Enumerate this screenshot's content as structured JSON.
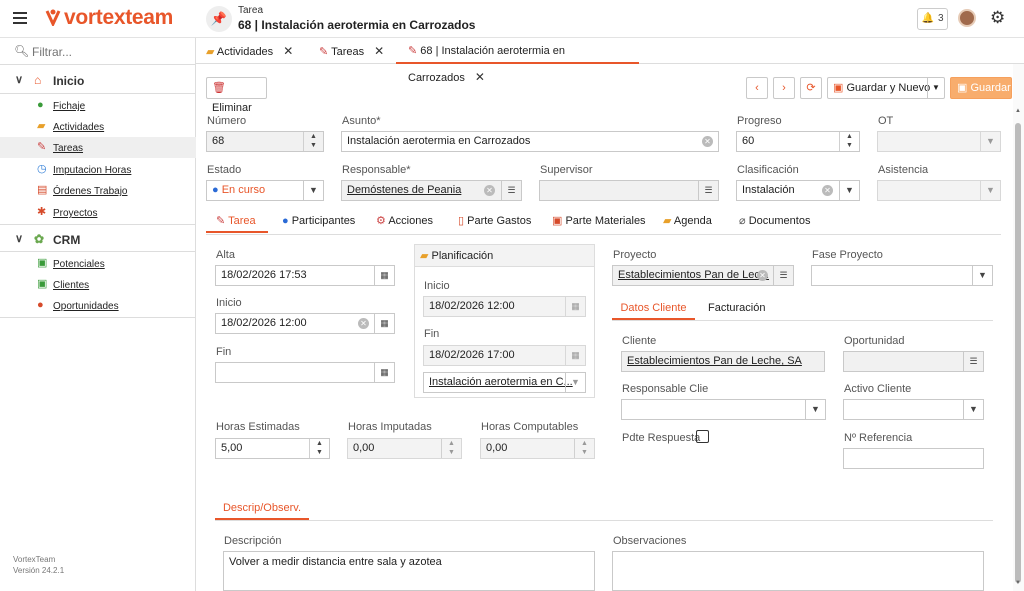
{
  "header": {
    "brand": "vortexteam",
    "task_kind": "Tarea",
    "task_title": "68 | Instalación aerotermia en Carrozados",
    "notifications_count": "3"
  },
  "sidebar": {
    "filter_placeholder": "Filtrar...",
    "sections": [
      {
        "label": "Inicio",
        "items": [
          {
            "label": "Fichaje",
            "icon": "user-clock-icon"
          },
          {
            "label": "Actividades",
            "icon": "activities-icon"
          },
          {
            "label": "Tareas",
            "icon": "tasks-icon",
            "selected": true
          },
          {
            "label": "Imputacion Horas",
            "icon": "clock-icon"
          },
          {
            "label": "Órdenes Trabajo",
            "icon": "work-orders-icon"
          },
          {
            "label": "Proyectos",
            "icon": "projects-icon"
          }
        ]
      },
      {
        "label": "CRM",
        "items": [
          {
            "label": "Potenciales",
            "icon": "leads-icon"
          },
          {
            "label": "Clientes",
            "icon": "clients-icon"
          },
          {
            "label": "Oportunidades",
            "icon": "opportunities-icon"
          }
        ]
      }
    ],
    "footer_app": "VortexTeam",
    "footer_version": "Versión 24.2.1"
  },
  "tabs": [
    {
      "label": "Actividades"
    },
    {
      "label": "Tareas"
    },
    {
      "label": "68 | Instalación aerotermia en Carrozados",
      "active": true
    }
  ],
  "toolbar": {
    "delete_label": "Eliminar",
    "save_new_label": "Guardar y Nuevo",
    "save_label": "Guardar"
  },
  "form": {
    "numero_label": "Número",
    "numero_value": "68",
    "asunto_label": "Asunto*",
    "asunto_value": "Instalación aerotermia en Carrozados",
    "progreso_label": "Progreso",
    "progreso_value": "60",
    "ot_label": "OT",
    "ot_value": "",
    "estado_label": "Estado",
    "estado_value": "En curso",
    "responsable_label": "Responsable*",
    "responsable_value": "Demóstenes de Peania",
    "supervisor_label": "Supervisor",
    "supervisor_value": "",
    "clasificacion_label": "Clasificación",
    "clasificacion_value": "Instalación",
    "asistencia_label": "Asistencia",
    "asistencia_value": ""
  },
  "detail_tabs": [
    "Tarea",
    "Participantes",
    "Acciones",
    "Parte Gastos",
    "Parte Materiales",
    "Agenda",
    "Documentos"
  ],
  "tarea": {
    "alta_label": "Alta",
    "alta_value": "18/02/2026 17:53",
    "inicio_label": "Inicio",
    "inicio_value": "18/02/2026 12:00",
    "fin_label": "Fin",
    "fin_value": "",
    "planificacion_title": "Planificación",
    "plan_inicio_label": "Inicio",
    "plan_inicio_value": "18/02/2026 12:00",
    "plan_fin_label": "Fin",
    "plan_fin_value": "18/02/2026 17:00",
    "plan_link_value": "Instalación aerotermia en C...",
    "horas_est_label": "Horas Estimadas",
    "horas_est_value": "5,00",
    "horas_imp_label": "Horas Imputadas",
    "horas_imp_value": "0,00",
    "horas_comp_label": "Horas Computables",
    "horas_comp_value": "0,00",
    "proyecto_label": "Proyecto",
    "proyecto_value": "Establecimientos Pan de Lec...",
    "fase_label": "Fase Proyecto",
    "fase_value": "",
    "sub_tabs": [
      "Datos Cliente",
      "Facturación"
    ],
    "cliente_label": "Cliente",
    "cliente_value": "Establecimientos Pan de Leche, SA",
    "oportunidad_label": "Oportunidad",
    "oportunidad_value": "",
    "resp_cliente_label": "Responsable Clie",
    "resp_cliente_value": "",
    "activo_label": "Activo Cliente",
    "activo_value": "",
    "pdte_label": "Pdte Respuesta",
    "nref_label": "Nº Referencia",
    "nref_value": "",
    "obs_tab": "Descrip/Observ.",
    "descripcion_label": "Descripción",
    "descripcion_value": "Volver a medir distancia entre sala y azotea",
    "observaciones_label": "Observaciones",
    "observaciones_value": ""
  },
  "colors": {
    "accent": "#e8562a",
    "save_button": "#f8ad6d",
    "selected_row": "#efefef"
  }
}
